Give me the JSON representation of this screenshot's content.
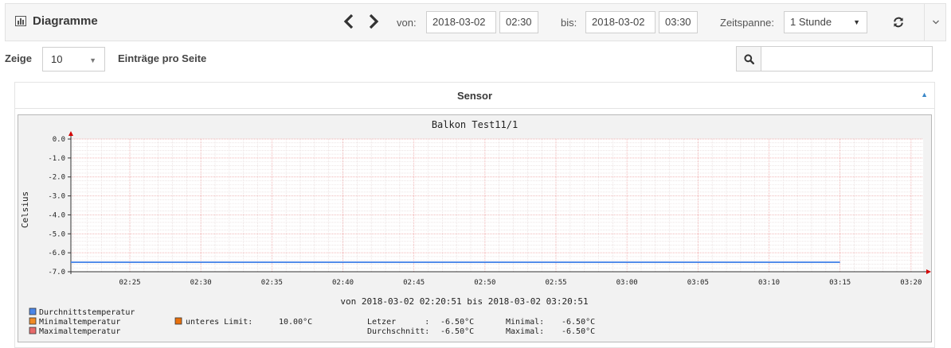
{
  "toolbar": {
    "title": "Diagramme",
    "prev_icon": "chevron-left-icon",
    "next_icon": "chevron-right-icon",
    "from_label": "von:",
    "from_date": "2018-03-02",
    "from_time": "02:30",
    "to_label": "bis:",
    "to_date": "2018-03-02",
    "to_time": "03:30",
    "span_label": "Zeitspanne:",
    "span_value": "1 Stunde",
    "refresh_icon": "refresh-icon",
    "toggle_icon": "chevron-down-icon"
  },
  "table_controls": {
    "show_label": "Zeige",
    "page_length": "10",
    "entries_label": "Einträge pro Seite",
    "search_icon": "search-icon",
    "search_value": ""
  },
  "table": {
    "column_header": "Sensor",
    "sort_icon": "sort-asc-icon"
  },
  "chart_data": {
    "type": "line",
    "title": "Balkon Test11/1",
    "ylabel": "Celsius",
    "xlabel": "von 2018-03-02 02:20:51 bis 2018-03-02 03:20:51",
    "ylim": [
      -7.0,
      0.0
    ],
    "y_ticks": [
      "0.0",
      "-1.0",
      "-2.0",
      "-3.0",
      "-4.0",
      "-5.0",
      "-6.0",
      "-7.0"
    ],
    "x_ticks": [
      "02:25",
      "02:30",
      "02:35",
      "02:40",
      "02:45",
      "02:50",
      "02:55",
      "03:00",
      "03:05",
      "03:10",
      "03:15",
      "03:20"
    ],
    "series": [
      {
        "name": "Durchnittstemperatur",
        "color": "#4a86e8",
        "x": [
          "02:20",
          "03:15"
        ],
        "y": [
          -6.5,
          -6.5
        ]
      },
      {
        "name": "Minimaltemperatur",
        "color": "#f08a24",
        "x": [],
        "y": []
      },
      {
        "name": "Maximaltemperatur",
        "color": "#e86a6a",
        "x": [],
        "y": []
      }
    ],
    "limit": {
      "label": "unteres Limit:",
      "value": "10.00°C",
      "color": "#e8700c"
    },
    "stats": {
      "last_label": "Letzer      :",
      "last_value": "-6.50°C",
      "avg_label": "Durchschnitt:",
      "avg_value": "-6.50°C",
      "min_label": "Minimal:",
      "min_value": "-6.50°C",
      "max_label": "Maximal:",
      "max_value": "-6.50°C"
    },
    "colors": {
      "grid_major": "#f0a0a0",
      "grid_minor": "#e2d4d4",
      "plot_bg": "#ffffff",
      "frame_bg": "#f2f2f2"
    }
  }
}
